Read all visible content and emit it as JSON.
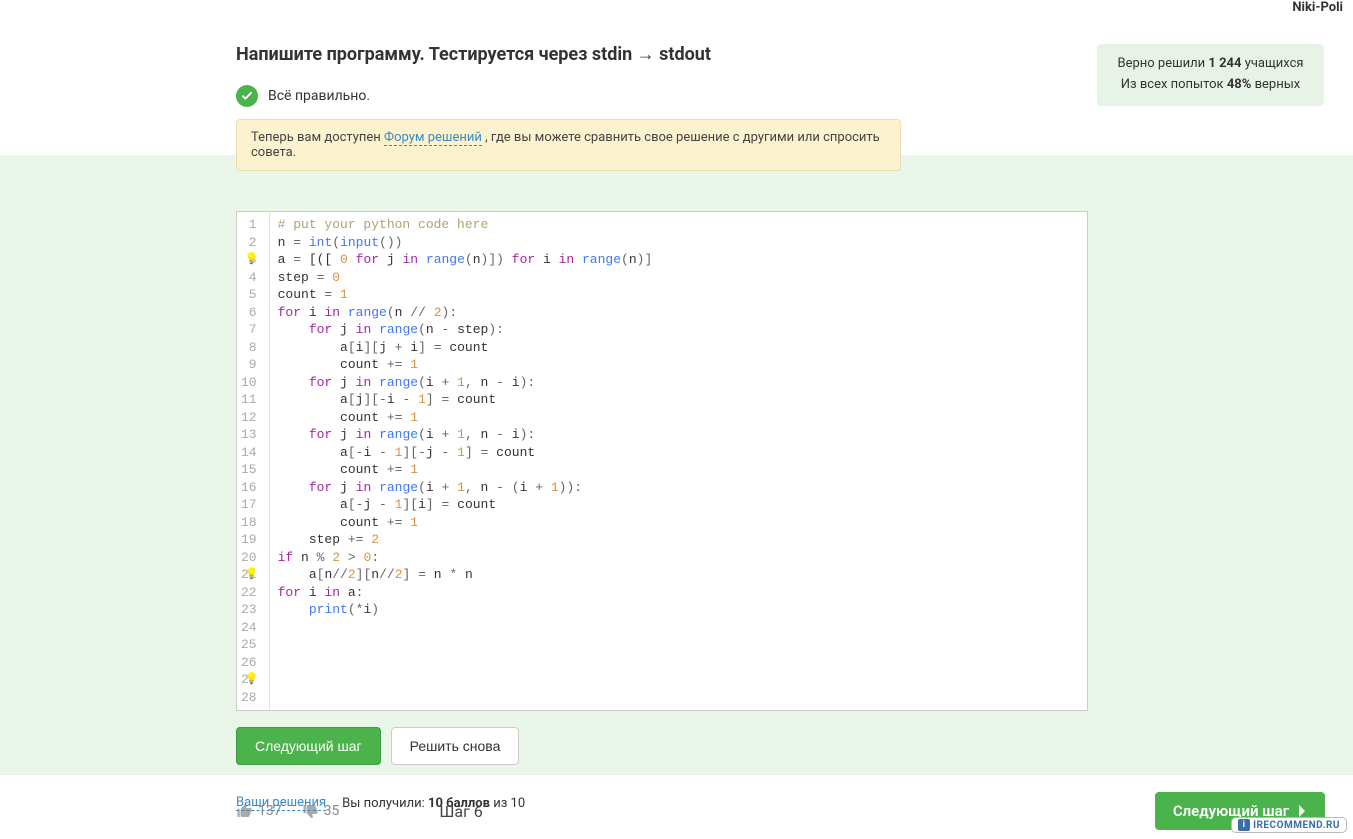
{
  "user_label": "Niki-Poli",
  "task": {
    "title": "Напишите программу. Тестируется через stdin → stdout",
    "correct_text": "Всё правильно."
  },
  "stats": {
    "prefix": "Верно решили",
    "solved_count": "1 244",
    "solved_suffix": "учащихся",
    "attempts_prefix": "Из всех попыток",
    "correct_pct": "48%",
    "attempts_suffix": "верных"
  },
  "forum": {
    "prefix": "Теперь вам доступен ",
    "link": "Форум решений",
    "suffix": " , где вы можете сравнить свое решение с другими или спросить совета."
  },
  "code_lines": [
    {
      "n": 1,
      "raw": "# put your python code here",
      "tokens": [
        {
          "t": "# put your python code here",
          "c": "c-comm"
        }
      ]
    },
    {
      "n": 2,
      "tokens": [
        {
          "t": "n "
        },
        {
          "t": "=",
          "c": "c-par"
        },
        {
          "t": " "
        },
        {
          "t": "int",
          "c": "c-fn"
        },
        {
          "t": "(",
          "c": "c-par"
        },
        {
          "t": "input",
          "c": "c-fn"
        },
        {
          "t": "())",
          "c": "c-par"
        }
      ]
    },
    {
      "n": 3,
      "bulb": true,
      "tokens": [
        {
          "t": "a "
        },
        {
          "t": "=",
          "c": "c-par"
        },
        {
          "t": " [([ "
        },
        {
          "t": "0",
          "c": "c-num"
        },
        {
          "t": " "
        },
        {
          "t": "for",
          "c": "c-kw"
        },
        {
          "t": " j "
        },
        {
          "t": "in",
          "c": "c-kw"
        },
        {
          "t": " "
        },
        {
          "t": "range",
          "c": "c-fn"
        },
        {
          "t": "(",
          "c": "c-par"
        },
        {
          "t": "n"
        },
        {
          "t": ")])",
          "c": "c-par"
        },
        {
          "t": " "
        },
        {
          "t": "for",
          "c": "c-kw"
        },
        {
          "t": " i "
        },
        {
          "t": "in",
          "c": "c-kw"
        },
        {
          "t": " "
        },
        {
          "t": "range",
          "c": "c-fn"
        },
        {
          "t": "(",
          "c": "c-par"
        },
        {
          "t": "n"
        },
        {
          "t": ")]",
          "c": "c-par"
        }
      ]
    },
    {
      "n": 4,
      "tokens": [
        {
          "t": "step "
        },
        {
          "t": "=",
          "c": "c-par"
        },
        {
          "t": " "
        },
        {
          "t": "0",
          "c": "c-num"
        }
      ]
    },
    {
      "n": 5,
      "tokens": [
        {
          "t": "count "
        },
        {
          "t": "=",
          "c": "c-par"
        },
        {
          "t": " "
        },
        {
          "t": "1",
          "c": "c-num"
        }
      ]
    },
    {
      "n": 6,
      "tokens": [
        {
          "t": "for",
          "c": "c-kw"
        },
        {
          "t": " i "
        },
        {
          "t": "in",
          "c": "c-kw"
        },
        {
          "t": " "
        },
        {
          "t": "range",
          "c": "c-fn"
        },
        {
          "t": "(",
          "c": "c-par"
        },
        {
          "t": "n "
        },
        {
          "t": "//",
          "c": "c-par"
        },
        {
          "t": " "
        },
        {
          "t": "2",
          "c": "c-num"
        },
        {
          "t": "):",
          "c": "c-par"
        }
      ]
    },
    {
      "n": 7,
      "tokens": [
        {
          "t": "    "
        },
        {
          "t": "for",
          "c": "c-kw"
        },
        {
          "t": " j "
        },
        {
          "t": "in",
          "c": "c-kw"
        },
        {
          "t": " "
        },
        {
          "t": "range",
          "c": "c-fn"
        },
        {
          "t": "(",
          "c": "c-par"
        },
        {
          "t": "n "
        },
        {
          "t": "-",
          "c": "c-par"
        },
        {
          "t": " step"
        },
        {
          "t": "):",
          "c": "c-par"
        }
      ]
    },
    {
      "n": 8,
      "tokens": [
        {
          "t": "        a"
        },
        {
          "t": "[",
          "c": "c-par"
        },
        {
          "t": "i"
        },
        {
          "t": "][",
          "c": "c-par"
        },
        {
          "t": "j "
        },
        {
          "t": "+",
          "c": "c-par"
        },
        {
          "t": " i"
        },
        {
          "t": "]",
          "c": "c-par"
        },
        {
          "t": " "
        },
        {
          "t": "=",
          "c": "c-par"
        },
        {
          "t": " count"
        }
      ]
    },
    {
      "n": 9,
      "tokens": [
        {
          "t": "        count "
        },
        {
          "t": "+=",
          "c": "c-par"
        },
        {
          "t": " "
        },
        {
          "t": "1",
          "c": "c-num"
        }
      ]
    },
    {
      "n": 10,
      "tokens": [
        {
          "t": "    "
        },
        {
          "t": "for",
          "c": "c-kw"
        },
        {
          "t": " j "
        },
        {
          "t": "in",
          "c": "c-kw"
        },
        {
          "t": " "
        },
        {
          "t": "range",
          "c": "c-fn"
        },
        {
          "t": "(",
          "c": "c-par"
        },
        {
          "t": "i "
        },
        {
          "t": "+",
          "c": "c-par"
        },
        {
          "t": " "
        },
        {
          "t": "1",
          "c": "c-num"
        },
        {
          "t": ", ",
          "c": "c-par"
        },
        {
          "t": "n "
        },
        {
          "t": "-",
          "c": "c-par"
        },
        {
          "t": " i"
        },
        {
          "t": "):",
          "c": "c-par"
        }
      ]
    },
    {
      "n": 11,
      "tokens": [
        {
          "t": "        a"
        },
        {
          "t": "[",
          "c": "c-par"
        },
        {
          "t": "j"
        },
        {
          "t": "][-",
          "c": "c-par"
        },
        {
          "t": "i "
        },
        {
          "t": "-",
          "c": "c-par"
        },
        {
          "t": " "
        },
        {
          "t": "1",
          "c": "c-num"
        },
        {
          "t": "]",
          "c": "c-par"
        },
        {
          "t": " "
        },
        {
          "t": "=",
          "c": "c-par"
        },
        {
          "t": " count"
        }
      ]
    },
    {
      "n": 12,
      "tokens": [
        {
          "t": "        count "
        },
        {
          "t": "+=",
          "c": "c-par"
        },
        {
          "t": " "
        },
        {
          "t": "1",
          "c": "c-num"
        }
      ]
    },
    {
      "n": 13,
      "tokens": [
        {
          "t": "    "
        },
        {
          "t": "for",
          "c": "c-kw"
        },
        {
          "t": " j "
        },
        {
          "t": "in",
          "c": "c-kw"
        },
        {
          "t": " "
        },
        {
          "t": "range",
          "c": "c-fn"
        },
        {
          "t": "(",
          "c": "c-par"
        },
        {
          "t": "i "
        },
        {
          "t": "+",
          "c": "c-par"
        },
        {
          "t": " "
        },
        {
          "t": "1",
          "c": "c-num"
        },
        {
          "t": ", ",
          "c": "c-par"
        },
        {
          "t": "n "
        },
        {
          "t": "-",
          "c": "c-par"
        },
        {
          "t": " i"
        },
        {
          "t": "):",
          "c": "c-par"
        }
      ]
    },
    {
      "n": 14,
      "tokens": [
        {
          "t": "        a"
        },
        {
          "t": "[-",
          "c": "c-par"
        },
        {
          "t": "i "
        },
        {
          "t": "-",
          "c": "c-par"
        },
        {
          "t": " "
        },
        {
          "t": "1",
          "c": "c-num"
        },
        {
          "t": "][-",
          "c": "c-par"
        },
        {
          "t": "j "
        },
        {
          "t": "-",
          "c": "c-par"
        },
        {
          "t": " "
        },
        {
          "t": "1",
          "c": "c-num"
        },
        {
          "t": "]",
          "c": "c-par"
        },
        {
          "t": " "
        },
        {
          "t": "=",
          "c": "c-par"
        },
        {
          "t": " count"
        }
      ]
    },
    {
      "n": 15,
      "tokens": [
        {
          "t": "        count "
        },
        {
          "t": "+=",
          "c": "c-par"
        },
        {
          "t": " "
        },
        {
          "t": "1",
          "c": "c-num"
        }
      ]
    },
    {
      "n": 16,
      "tokens": [
        {
          "t": "    "
        },
        {
          "t": "for",
          "c": "c-kw"
        },
        {
          "t": " j "
        },
        {
          "t": "in",
          "c": "c-kw"
        },
        {
          "t": " "
        },
        {
          "t": "range",
          "c": "c-fn"
        },
        {
          "t": "(",
          "c": "c-par"
        },
        {
          "t": "i "
        },
        {
          "t": "+",
          "c": "c-par"
        },
        {
          "t": " "
        },
        {
          "t": "1",
          "c": "c-num"
        },
        {
          "t": ", ",
          "c": "c-par"
        },
        {
          "t": "n "
        },
        {
          "t": "-",
          "c": "c-par"
        },
        {
          "t": " "
        },
        {
          "t": "(",
          "c": "c-par"
        },
        {
          "t": "i "
        },
        {
          "t": "+",
          "c": "c-par"
        },
        {
          "t": " "
        },
        {
          "t": "1",
          "c": "c-num"
        },
        {
          "t": ")):",
          "c": "c-par"
        }
      ]
    },
    {
      "n": 17,
      "tokens": [
        {
          "t": "        a"
        },
        {
          "t": "[-",
          "c": "c-par"
        },
        {
          "t": "j "
        },
        {
          "t": "-",
          "c": "c-par"
        },
        {
          "t": " "
        },
        {
          "t": "1",
          "c": "c-num"
        },
        {
          "t": "][",
          "c": "c-par"
        },
        {
          "t": "i"
        },
        {
          "t": "]",
          "c": "c-par"
        },
        {
          "t": " "
        },
        {
          "t": "=",
          "c": "c-par"
        },
        {
          "t": " count"
        }
      ]
    },
    {
      "n": 18,
      "tokens": [
        {
          "t": "        count "
        },
        {
          "t": "+=",
          "c": "c-par"
        },
        {
          "t": " "
        },
        {
          "t": "1",
          "c": "c-num"
        }
      ]
    },
    {
      "n": 19,
      "tokens": [
        {
          "t": "    step "
        },
        {
          "t": "+=",
          "c": "c-par"
        },
        {
          "t": " "
        },
        {
          "t": "2",
          "c": "c-num"
        }
      ]
    },
    {
      "n": 20,
      "tokens": [
        {
          "t": "if",
          "c": "c-kw"
        },
        {
          "t": " n "
        },
        {
          "t": "%",
          "c": "c-par"
        },
        {
          "t": " "
        },
        {
          "t": "2",
          "c": "c-num"
        },
        {
          "t": " "
        },
        {
          "t": ">",
          "c": "c-par"
        },
        {
          "t": " "
        },
        {
          "t": "0",
          "c": "c-num"
        },
        {
          "t": ":",
          "c": "c-par"
        }
      ]
    },
    {
      "n": 21,
      "bulb": true,
      "tokens": [
        {
          "t": "    a"
        },
        {
          "t": "[",
          "c": "c-par"
        },
        {
          "t": "n"
        },
        {
          "t": "//",
          "c": "c-par"
        },
        {
          "t": "2",
          "c": "c-num"
        },
        {
          "t": "][",
          "c": "c-par"
        },
        {
          "t": "n"
        },
        {
          "t": "//",
          "c": "c-par"
        },
        {
          "t": "2",
          "c": "c-num"
        },
        {
          "t": "]",
          "c": "c-par"
        },
        {
          "t": " "
        },
        {
          "t": "=",
          "c": "c-par"
        },
        {
          "t": " n "
        },
        {
          "t": "*",
          "c": "c-par"
        },
        {
          "t": " n"
        }
      ]
    },
    {
      "n": 22,
      "tokens": [
        {
          "t": "for",
          "c": "c-kw"
        },
        {
          "t": " i "
        },
        {
          "t": "in",
          "c": "c-kw"
        },
        {
          "t": " a"
        },
        {
          "t": ":",
          "c": "c-par"
        }
      ]
    },
    {
      "n": 23,
      "tokens": [
        {
          "t": "    "
        },
        {
          "t": "print",
          "c": "c-fn"
        },
        {
          "t": "(*",
          "c": "c-par"
        },
        {
          "t": "i"
        },
        {
          "t": ")",
          "c": "c-par"
        }
      ]
    },
    {
      "n": 24,
      "tokens": [
        {
          "t": ""
        }
      ]
    },
    {
      "n": 25,
      "tokens": [
        {
          "t": ""
        }
      ]
    },
    {
      "n": 26,
      "tokens": [
        {
          "t": ""
        }
      ]
    },
    {
      "n": 27,
      "bulb": true,
      "tokens": [
        {
          "t": ""
        }
      ]
    },
    {
      "n": 28,
      "tokens": [
        {
          "t": ""
        }
      ]
    }
  ],
  "buttons": {
    "next_step": "Следующий шаг",
    "solve_again": "Решить снова"
  },
  "result": {
    "your_solutions": "Ваши решения",
    "you_got_prefix": "Вы получили: ",
    "score_bold": "10 баллов",
    "score_suffix": " из 10"
  },
  "footer": {
    "likes": "137",
    "dislikes": "35",
    "step_label": "Шаг 6",
    "next_button": "Следующий шаг"
  },
  "watermark": "IRECOMMEND.RU"
}
